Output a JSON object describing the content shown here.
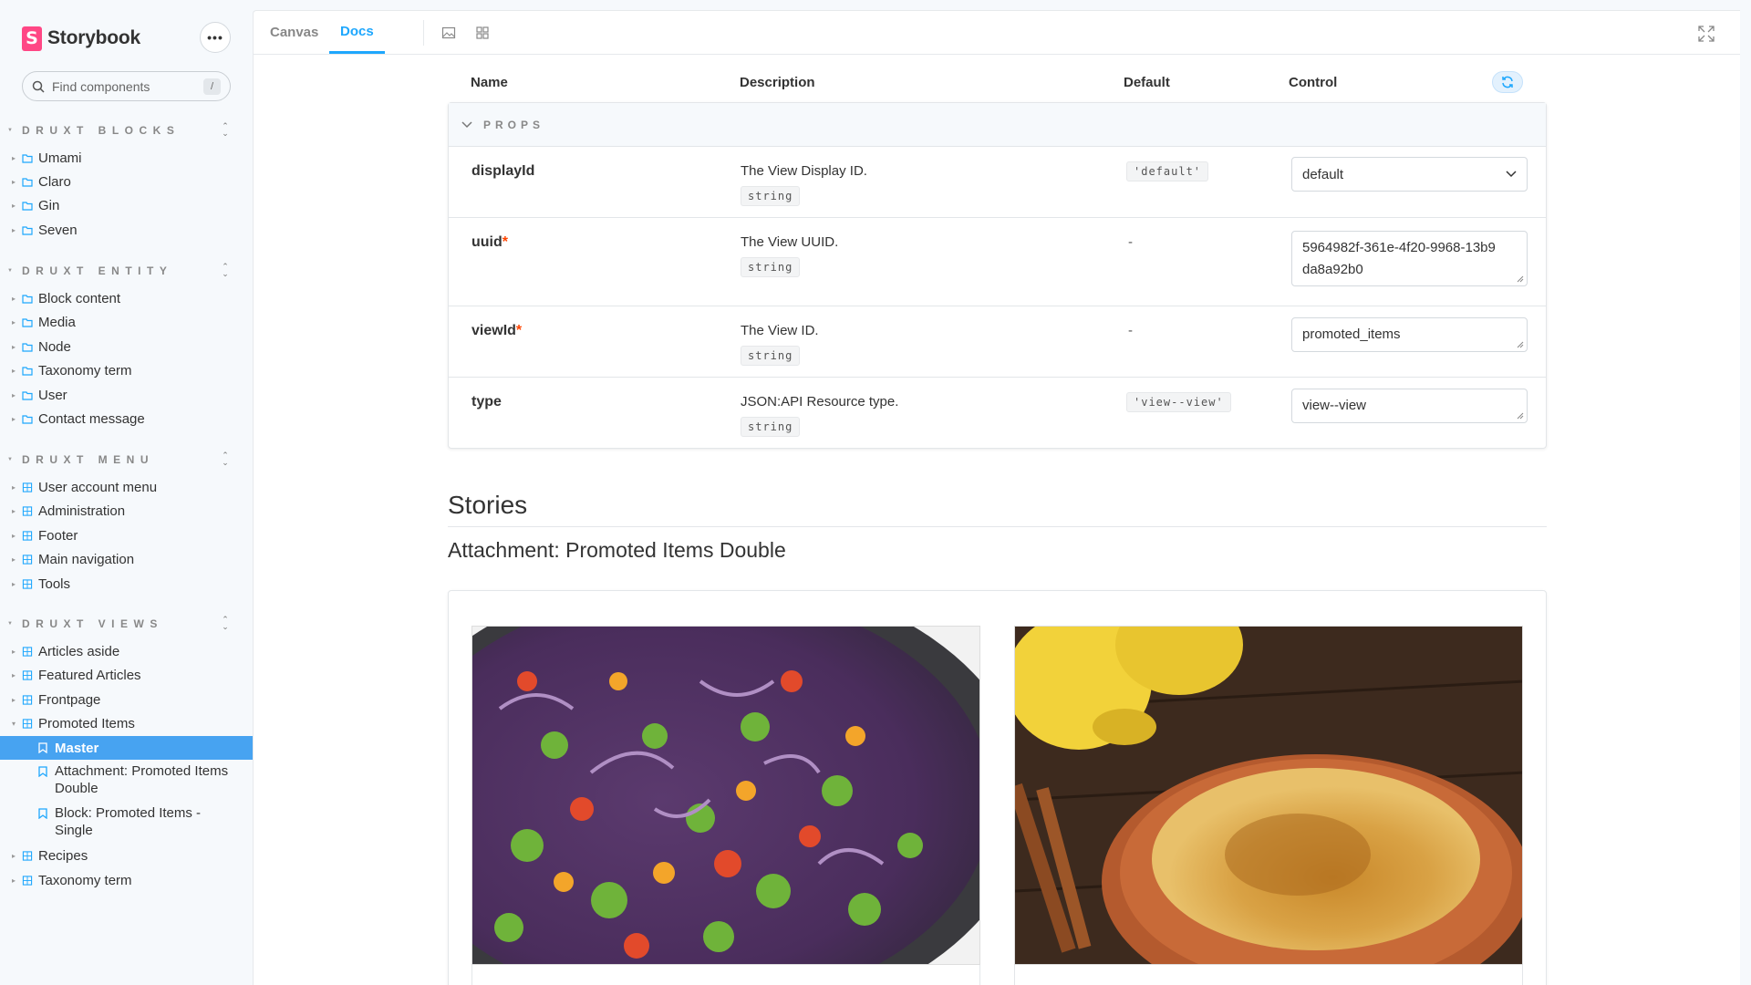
{
  "app": {
    "name": "Storybook",
    "logo_letter": "S",
    "brand_color": "#ff4785",
    "accent_color": "#1ea7fd"
  },
  "sidebar": {
    "menu_icon": "ellipsis-icon",
    "search": {
      "placeholder": "Find components",
      "shortcut": "/"
    },
    "groups": [
      {
        "title": "DRUXT BLOCKS",
        "items": [
          "Umami",
          "Claro",
          "Gin",
          "Seven"
        ]
      },
      {
        "title": "DRUXT ENTITY",
        "items": [
          "Block content",
          "Media",
          "Node",
          "Taxonomy term",
          "User",
          "Contact message"
        ]
      },
      {
        "title": "DRUXT MENU",
        "items": [
          "User account menu",
          "Administration",
          "Footer",
          "Main navigation",
          "Tools"
        ]
      },
      {
        "title": "DRUXT VIEWS",
        "items": [
          "Articles aside",
          "Featured Articles",
          "Frontpage",
          "Promoted Items"
        ],
        "stories": [
          "Master",
          "Attachment: Promoted Items Double",
          "Block: Promoted Items - Single"
        ],
        "items_after": [
          "Recipes",
          "Taxonomy term"
        ]
      }
    ],
    "selected_story": "Master"
  },
  "toolbar": {
    "tabs": [
      "Canvas",
      "Docs"
    ],
    "active_tab": "Docs"
  },
  "args_table": {
    "headers": {
      "name": "Name",
      "description": "Description",
      "default": "Default",
      "control": "Control"
    },
    "section": "PROPS",
    "rows": [
      {
        "name": "displayId",
        "required": false,
        "description": "The View Display ID.",
        "type": "string",
        "default": "'default'",
        "control_value": "default",
        "control_type": "select"
      },
      {
        "name": "uuid",
        "required": true,
        "description": "The View UUID.",
        "type": "string",
        "default": "-",
        "control_value": "5964982f-361e-4f20-9968-13b9da8a92b0",
        "control_type": "text"
      },
      {
        "name": "viewId",
        "required": true,
        "description": "The View ID.",
        "type": "string",
        "default": "-",
        "control_value": "promoted_items",
        "control_type": "text"
      },
      {
        "name": "type",
        "required": false,
        "description": "JSON:API Resource type.",
        "type": "string",
        "default": "'view--view'",
        "control_value": "view--view",
        "control_type": "text"
      }
    ]
  },
  "stories_section": {
    "title": "Stories",
    "story_title": "Attachment: Promoted Items Double"
  },
  "preview": {
    "images": [
      "vegetable-stir-fry-photo",
      "creme-brulee-photo"
    ]
  }
}
